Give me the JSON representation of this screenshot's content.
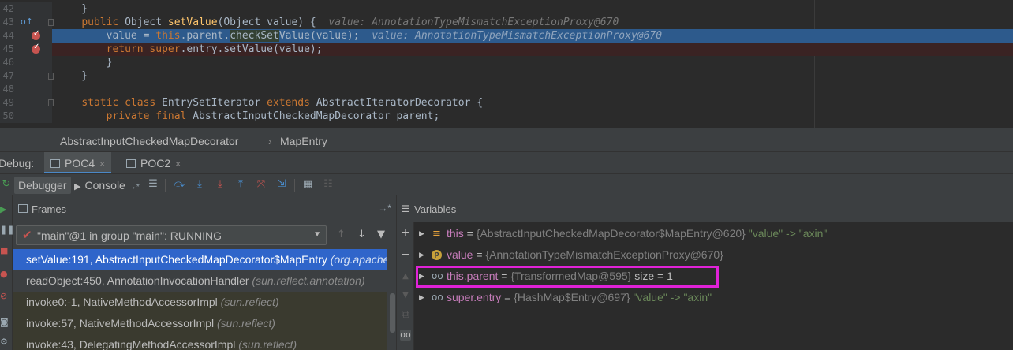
{
  "editor": {
    "lines": [
      {
        "num": "42",
        "text": "    }",
        "highlight": "none",
        "marker": "none"
      },
      {
        "num": "43",
        "text": "",
        "highlight": "none",
        "marker": "override"
      },
      {
        "num": "44",
        "text": "",
        "highlight": "exec",
        "marker": "breakpoint"
      },
      {
        "num": "45",
        "text": "",
        "highlight": "bp",
        "marker": "breakpoint"
      },
      {
        "num": "46",
        "text": "        }",
        "highlight": "none",
        "marker": "none"
      },
      {
        "num": "47",
        "text": "    }",
        "highlight": "none",
        "marker": "none"
      },
      {
        "num": "48",
        "text": "",
        "highlight": "none",
        "marker": "none"
      },
      {
        "num": "49",
        "text": "",
        "highlight": "none",
        "marker": "none"
      },
      {
        "num": "50",
        "text": "",
        "highlight": "none",
        "marker": "none"
      }
    ],
    "line43": {
      "kw1": "public ",
      "type": "Object ",
      "fn": "setValue",
      "rest": "(Object value) {  ",
      "inline": "value: AnnotationTypeMismatchExceptionProxy@670"
    },
    "line44": {
      "pre": "value = ",
      "kw": "this",
      "mid": ".parent.",
      "hl": "checkSet",
      "post": "Value(value);  ",
      "inline": "value: AnnotationTypeMismatchExceptionProxy@670"
    },
    "line45": {
      "kw1": "return ",
      "kw2": "super",
      "rest": ".entry.setValue(value);"
    },
    "line49": {
      "kw1": "static class ",
      "name": "EntrySetIterator ",
      "kw2": "extends ",
      "rest": "AbstractIteratorDecorator {"
    },
    "line50": {
      "kw1": "private final ",
      "rest": "AbstractInputCheckedMapDecorator parent;"
    }
  },
  "breadcrumb": {
    "class": "AbstractInputCheckedMapDecorator",
    "sep": "›",
    "member": "MapEntry"
  },
  "debug": {
    "label": "Debug:",
    "tabs": [
      {
        "label": "POC4",
        "close": "×",
        "active": true
      },
      {
        "label": "POC2",
        "close": "×",
        "active": false
      }
    ]
  },
  "toolbar": {
    "debugger_label": "Debugger",
    "console_label": "Console",
    "console_pin": "→*"
  },
  "frames": {
    "title": "Frames",
    "pin": "→*",
    "thread": "\"main\"@1 in group \"main\": RUNNING",
    "items": [
      {
        "method": "setValue:191, AbstractInputCheckedMapDecorator$MapEntry ",
        "pkg": "(org.apache.commons.collections.map)",
        "style": "sel"
      },
      {
        "method": "readObject:450, AnnotationInvocationHandler ",
        "pkg": "(sun.reflect.annotation)",
        "style": "normal"
      },
      {
        "method": "invoke0:-1, NativeMethodAccessorImpl ",
        "pkg": "(sun.reflect)",
        "style": "lib"
      },
      {
        "method": "invoke:57, NativeMethodAccessorImpl ",
        "pkg": "(sun.reflect)",
        "style": "lib"
      },
      {
        "method": "invoke:43, DelegatingMethodAccessorImpl ",
        "pkg": "(sun.reflect)",
        "style": "lib"
      }
    ]
  },
  "variables": {
    "title": "Variables",
    "items": [
      {
        "icon": "fields-icon",
        "name": "this",
        "eq": " = ",
        "type": "{AbstractInputCheckedMapDecorator$MapEntry@620} ",
        "value": "\"value\" -> \"axin\"",
        "size": ""
      },
      {
        "icon": "parameter-icon",
        "name": "value",
        "eq": " = ",
        "type": "{AnnotationTypeMismatchExceptionProxy@670}",
        "value": "",
        "size": ""
      },
      {
        "icon": "watch-glasses-icon",
        "name": "this.parent",
        "eq": " = ",
        "type": "{TransformedMap@595} ",
        "value": "",
        "size": " size = 1"
      },
      {
        "icon": "watch-glasses-icon",
        "name": "super.entry",
        "eq": " = ",
        "type": "{HashMap$Entry@697} ",
        "value": "\"value\" -> \"axin\"",
        "size": ""
      }
    ]
  },
  "colors": {
    "exec_line": "#2d5a8c",
    "breakpoint": "#c75450",
    "selection": "#2f65ca",
    "annotation_box": "#e022d8",
    "var_name": "#c77dbb",
    "string_value": "#6a8759"
  }
}
